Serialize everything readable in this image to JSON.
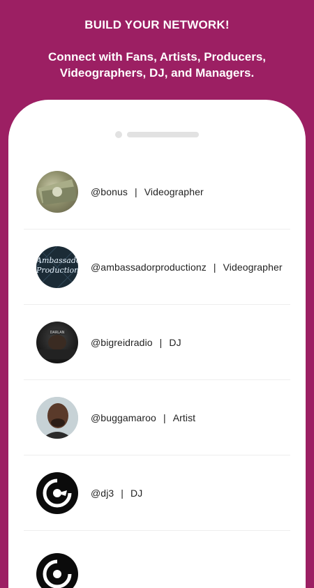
{
  "header": {
    "title": "BUILD YOUR NETWORK!",
    "subtitle_line1": "Connect with Fans, Artists, Producers,",
    "subtitle_line2": "Videographers, DJ, and Managers."
  },
  "users": [
    {
      "handle": "@bonus",
      "separator": "|",
      "role": "Videographer",
      "avatar": "money-avatar"
    },
    {
      "handle": "@ambassadorproductionz",
      "separator": "|",
      "role": "Videographer",
      "avatar": "ambassador-logo-avatar",
      "avatar_text": "Ambassador Productionz"
    },
    {
      "handle": "@bigreidradio",
      "separator": "|",
      "role": "DJ",
      "avatar": "radio-host-avatar"
    },
    {
      "handle": "@buggamaroo",
      "separator": "|",
      "role": "Artist",
      "avatar": "person-avatar"
    },
    {
      "handle": "@dj3",
      "separator": "|",
      "role": "DJ",
      "avatar": "dj-logo-avatar"
    }
  ],
  "colors": {
    "background": "#9c1f63",
    "card": "#ffffff",
    "text": "#222222"
  }
}
